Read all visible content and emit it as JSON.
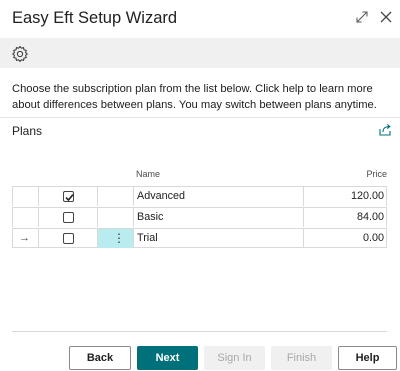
{
  "window": {
    "title": "Easy Eft Setup Wizard"
  },
  "instructions": "Choose the subscription plan from the list below. Click help to learn more about differences between plans. You may switch between plans anytime.",
  "plans": {
    "title": "Plans",
    "columns": {
      "name": "Name",
      "price": "Price"
    },
    "rows": [
      {
        "name": "Advanced",
        "price": "120.00",
        "checked": true
      },
      {
        "name": "Basic",
        "price": "84.00",
        "checked": false
      },
      {
        "name": "Trial",
        "price": "0.00",
        "checked": false
      }
    ],
    "current_row_marker": "→",
    "row_menu_glyph": "⋮"
  },
  "buttons": {
    "back": "Back",
    "next": "Next",
    "sign_in": "Sign In",
    "finish": "Finish",
    "help": "Help"
  },
  "colors": {
    "primary": "#00707a",
    "selected_cell": "#b9ecef",
    "disabled_button": "#f0f0f0"
  },
  "icons": {
    "expand": "expand-icon",
    "close": "close-icon",
    "settings": "gear-icon",
    "share": "share-icon",
    "checkbox_checked": "checkmark-icon"
  }
}
